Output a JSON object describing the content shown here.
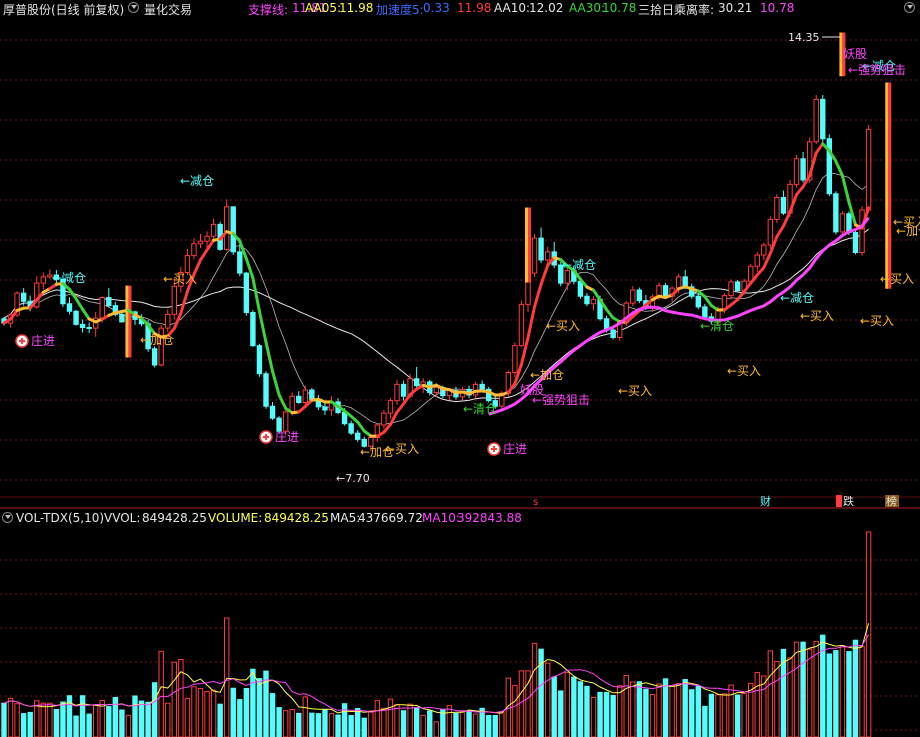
{
  "header": {
    "stock_title": "厚普股份(日线 前复权)",
    "indicator_title": "量化交易",
    "support_label": "支撑线: ",
    "support_value": "11.81",
    "aa05_label": "AA05: ",
    "aa05_value": "11.98",
    "accel_label": "加速度5: ",
    "accel_value": "0.33",
    "mid_value": "11.98",
    "aa10_label": "AA10: ",
    "aa10_value": "12.02",
    "aa30_label": "AA30: ",
    "aa30_value": "10.78",
    "bias_label": "三拾日乘离率: ",
    "bias_value": "30.21",
    "last_value": "10.78"
  },
  "volume_header": {
    "name": "VOL-TDX(5,10)",
    "vvol_label": "VVOL: ",
    "vvol_value": "849428.25",
    "volume_label": "VOLUME: ",
    "volume_value": "849428.25",
    "ma5_label": "MA5: ",
    "ma5_value": "437669.72",
    "ma10_label": "MA10: ",
    "ma10_value": "392843.88"
  },
  "colors": {
    "background": "#000000",
    "up": "#ff3b3b",
    "down": "#54fcfc",
    "grid": "#7a1414",
    "ma5": "#ffff4c",
    "ma10": "#ff44ff",
    "white": "#e6e6e6",
    "green": "#3bd43b",
    "orange": "#ffbb33",
    "cyan": "#54fcfc",
    "magenta": "#ff44ff"
  },
  "chart_data": [
    {
      "type": "candlestick",
      "price_range": [
        7.0,
        14.6
      ],
      "high_marker": "14.35",
      "low_marker": "7.70",
      "ohlc": [
        [
          9.82,
          9.85,
          9.71,
          9.75
        ],
        [
          9.75,
          9.91,
          9.68,
          9.88
        ],
        [
          9.88,
          10.26,
          9.85,
          10.23
        ],
        [
          10.23,
          10.31,
          10.03,
          10.1
        ],
        [
          10.1,
          10.19,
          9.94,
          10.01
        ],
        [
          10.01,
          10.5,
          9.98,
          10.39
        ],
        [
          10.39,
          10.56,
          10.29,
          10.49
        ],
        [
          10.49,
          10.61,
          10.46,
          10.52
        ],
        [
          10.52,
          10.6,
          10.34,
          10.45
        ],
        [
          10.45,
          10.52,
          10.01,
          10.06
        ],
        [
          10.06,
          10.16,
          9.89,
          9.94
        ],
        [
          9.94,
          9.96,
          9.71,
          9.73
        ],
        [
          9.73,
          9.81,
          9.6,
          9.68
        ],
        [
          9.68,
          9.76,
          9.59,
          9.67
        ],
        [
          9.67,
          9.93,
          9.53,
          9.83
        ],
        [
          9.83,
          10.18,
          9.76,
          10.16
        ],
        [
          10.16,
          10.31,
          10.0,
          10.03
        ],
        [
          10.03,
          10.09,
          9.86,
          9.89
        ],
        [
          9.89,
          9.94,
          9.76,
          9.77
        ],
        [
          9.77,
          9.97,
          9.68,
          9.93
        ],
        [
          9.93,
          9.95,
          9.72,
          9.81
        ],
        [
          9.81,
          9.89,
          9.7,
          9.74
        ],
        [
          9.74,
          9.8,
          9.29,
          9.34
        ],
        [
          9.34,
          9.38,
          9.04,
          9.08
        ],
        [
          9.08,
          9.72,
          9.06,
          9.67
        ],
        [
          9.67,
          9.97,
          9.61,
          9.89
        ],
        [
          9.89,
          10.47,
          9.81,
          10.34
        ],
        [
          10.34,
          10.65,
          10.24,
          10.56
        ],
        [
          10.56,
          10.94,
          10.52,
          10.83
        ],
        [
          10.83,
          11.11,
          10.77,
          11.02
        ],
        [
          11.02,
          11.18,
          10.95,
          11.06
        ],
        [
          11.06,
          11.22,
          10.93,
          11.14
        ],
        [
          11.14,
          11.42,
          11.04,
          11.33
        ],
        [
          11.33,
          11.37,
          10.91,
          10.93
        ],
        [
          10.93,
          11.73,
          10.9,
          11.61
        ],
        [
          11.61,
          11.62,
          10.84,
          10.89
        ],
        [
          10.89,
          11.11,
          10.5,
          10.55
        ],
        [
          10.55,
          10.57,
          9.87,
          9.92
        ],
        [
          9.92,
          9.96,
          9.37,
          9.39
        ],
        [
          9.39,
          9.42,
          8.89,
          8.94
        ],
        [
          8.94,
          8.98,
          8.38,
          8.42
        ],
        [
          8.42,
          8.49,
          8.2,
          8.23
        ],
        [
          8.23,
          8.26,
          7.98,
          8.02
        ],
        [
          8.02,
          8.39,
          7.95,
          8.33
        ],
        [
          8.33,
          8.64,
          8.27,
          8.58
        ],
        [
          8.58,
          8.66,
          8.46,
          8.48
        ],
        [
          8.48,
          8.75,
          8.39,
          8.68
        ],
        [
          8.68,
          8.71,
          8.49,
          8.51
        ],
        [
          8.51,
          8.6,
          8.36,
          8.41
        ],
        [
          8.41,
          8.49,
          8.28,
          8.36
        ],
        [
          8.36,
          8.58,
          8.27,
          8.49
        ],
        [
          8.49,
          8.55,
          8.29,
          8.32
        ],
        [
          8.32,
          8.39,
          8.11,
          8.14
        ],
        [
          8.14,
          8.19,
          7.96,
          7.99
        ],
        [
          7.99,
          8.04,
          7.85,
          7.89
        ],
        [
          7.89,
          7.93,
          7.76,
          7.78
        ],
        [
          7.78,
          7.96,
          7.7,
          7.92
        ],
        [
          7.92,
          8.15,
          7.85,
          8.12
        ],
        [
          8.12,
          8.36,
          8.06,
          8.31
        ],
        [
          8.31,
          8.55,
          8.22,
          8.51
        ],
        [
          8.51,
          8.84,
          8.44,
          8.77
        ],
        [
          8.77,
          8.83,
          8.51,
          8.58
        ],
        [
          8.58,
          8.94,
          8.55,
          8.86
        ],
        [
          8.86,
          9.05,
          8.71,
          8.75
        ],
        [
          8.75,
          8.87,
          8.63,
          8.81
        ],
        [
          8.81,
          8.84,
          8.59,
          8.64
        ],
        [
          8.64,
          8.79,
          8.57,
          8.72
        ],
        [
          8.72,
          8.75,
          8.55,
          8.59
        ],
        [
          8.59,
          8.71,
          8.52,
          8.67
        ],
        [
          8.67,
          8.73,
          8.53,
          8.57
        ],
        [
          8.57,
          8.73,
          8.52,
          8.69
        ],
        [
          8.69,
          8.75,
          8.55,
          8.6
        ],
        [
          8.6,
          8.81,
          8.54,
          8.77
        ],
        [
          8.77,
          8.83,
          8.64,
          8.69
        ],
        [
          8.69,
          8.73,
          8.48,
          8.51
        ],
        [
          8.51,
          8.59,
          8.38,
          8.42
        ],
        [
          8.42,
          8.66,
          8.37,
          8.63
        ],
        [
          8.63,
          8.99,
          8.57,
          8.96
        ],
        [
          8.96,
          9.44,
          8.89,
          9.39
        ],
        [
          9.39,
          10.11,
          9.37,
          10.05
        ],
        [
          10.05,
          10.62,
          9.93,
          10.55
        ],
        [
          10.55,
          11.18,
          10.49,
          11.11
        ],
        [
          11.11,
          11.28,
          10.71,
          10.76
        ],
        [
          10.76,
          10.97,
          10.61,
          10.89
        ],
        [
          10.89,
          11.05,
          10.63,
          10.68
        ],
        [
          10.68,
          10.73,
          10.34,
          10.39
        ],
        [
          10.39,
          10.64,
          10.28,
          10.59
        ],
        [
          10.59,
          10.66,
          10.37,
          10.42
        ],
        [
          10.42,
          10.46,
          10.14,
          10.18
        ],
        [
          10.18,
          10.23,
          10.02,
          10.06
        ],
        [
          10.06,
          10.18,
          9.95,
          10.13
        ],
        [
          10.13,
          10.19,
          9.79,
          9.82
        ],
        [
          9.82,
          9.87,
          9.6,
          9.64
        ],
        [
          9.64,
          9.71,
          9.49,
          9.52
        ],
        [
          9.52,
          9.79,
          9.47,
          9.76
        ],
        [
          9.76,
          10.1,
          9.7,
          10.07
        ],
        [
          10.07,
          10.34,
          10.02,
          10.28
        ],
        [
          10.28,
          10.32,
          10.07,
          10.11
        ],
        [
          10.11,
          10.2,
          9.96,
          9.99
        ],
        [
          9.99,
          10.21,
          9.93,
          10.17
        ],
        [
          10.17,
          10.4,
          10.12,
          10.35
        ],
        [
          10.35,
          10.39,
          10.15,
          10.18
        ],
        [
          10.18,
          10.34,
          10.09,
          10.31
        ],
        [
          10.31,
          10.54,
          10.23,
          10.49
        ],
        [
          10.49,
          10.6,
          10.29,
          10.33
        ],
        [
          10.33,
          10.38,
          10.14,
          10.18
        ],
        [
          10.18,
          10.23,
          9.97,
          10.01
        ],
        [
          10.01,
          10.06,
          9.81,
          9.85
        ],
        [
          9.85,
          9.91,
          9.74,
          9.78
        ],
        [
          9.78,
          10.02,
          9.71,
          9.98
        ],
        [
          9.98,
          10.23,
          9.91,
          10.19
        ],
        [
          10.19,
          10.45,
          10.13,
          10.41
        ],
        [
          10.41,
          10.44,
          10.24,
          10.27
        ],
        [
          10.27,
          10.46,
          10.2,
          10.42
        ],
        [
          10.42,
          10.7,
          10.35,
          10.66
        ],
        [
          10.66,
          10.89,
          10.57,
          10.84
        ],
        [
          10.84,
          11.04,
          10.76,
          11.0
        ],
        [
          11.0,
          11.46,
          10.94,
          11.41
        ],
        [
          11.41,
          11.81,
          11.35,
          11.76
        ],
        [
          11.76,
          11.87,
          11.48,
          11.51
        ],
        [
          11.51,
          12.04,
          11.45,
          11.97
        ],
        [
          11.97,
          12.44,
          11.92,
          12.38
        ],
        [
          12.38,
          12.49,
          12.0,
          12.04
        ],
        [
          12.04,
          12.72,
          11.99,
          12.65
        ],
        [
          12.65,
          13.4,
          12.62,
          13.33
        ],
        [
          13.33,
          13.4,
          12.65,
          12.7
        ],
        [
          12.7,
          12.77,
          11.78,
          11.82
        ],
        [
          11.82,
          11.86,
          11.17,
          11.21
        ],
        [
          11.21,
          11.54,
          11.16,
          11.5
        ],
        [
          11.5,
          11.54,
          11.16,
          11.2
        ],
        [
          11.2,
          11.27,
          10.85,
          10.88
        ],
        [
          10.88,
          11.62,
          10.83,
          11.56
        ],
        [
          11.56,
          12.92,
          11.52,
          12.85
        ]
      ],
      "series": [
        {
          "name": "AA05",
          "value": "11.98"
        },
        {
          "name": "AA10",
          "value": "12.02"
        },
        {
          "name": "AA30",
          "value": "10.78"
        },
        {
          "name": "支撑线",
          "value": "11.81"
        }
      ]
    },
    {
      "type": "bar",
      "series": [
        {
          "name": "VOLUME",
          "value": "849428.25"
        },
        {
          "name": "MA5",
          "value": "437669.72"
        },
        {
          "name": "MA10",
          "value": "392843.88"
        }
      ],
      "volumes": [
        140000,
        160000,
        138000,
        97000,
        102000,
        150000,
        140000,
        140000,
        114000,
        145000,
        171000,
        87000,
        171000,
        95000,
        132000,
        151000,
        126000,
        164000,
        112000,
        90000,
        170000,
        149000,
        144000,
        225000,
        355000,
        140000,
        310000,
        321000,
        160000,
        208000,
        201000,
        188000,
        194000,
        136000,
        493000,
        202000,
        155000,
        201000,
        281000,
        242000,
        273000,
        180000,
        122000,
        109000,
        114000,
        98000,
        166000,
        99000,
        97000,
        113000,
        97000,
        91000,
        138000,
        89000,
        118000,
        78000,
        108000,
        151000,
        119000,
        157000,
        134000,
        109000,
        136000,
        118000,
        90000,
        108000,
        63000,
        114000,
        130000,
        98000,
        109000,
        109000,
        95000,
        119000,
        89000,
        89000,
        104000,
        244000,
        214000,
        274000,
        274000,
        388000,
        364000,
        306000,
        249000,
        191000,
        267000,
        248000,
        229000,
        210000,
        164000,
        185000,
        185000,
        172000,
        212000,
        255000,
        228000,
        229000,
        198000,
        176000,
        220000,
        241000,
        212000,
        221000,
        238000,
        196000,
        211000,
        127000,
        177000,
        175000,
        179000,
        215000,
        174000,
        180000,
        222000,
        267000,
        253000,
        357000,
        313000,
        363000,
        328000,
        393000,
        393000,
        364000,
        396000,
        422000,
        344000,
        358000,
        378000,
        354000,
        401000,
        376000,
        849428
      ]
    }
  ],
  "labels": {
    "reduce": "←减仓",
    "add": "←加仓",
    "buy": "←买入",
    "clear": "←清仓",
    "zhuangjin": "庄进",
    "yaogu": "妖股",
    "strong": "←强势狙击",
    "cai": "财",
    "die": "跌",
    "bang": "榜",
    "s": "s"
  }
}
